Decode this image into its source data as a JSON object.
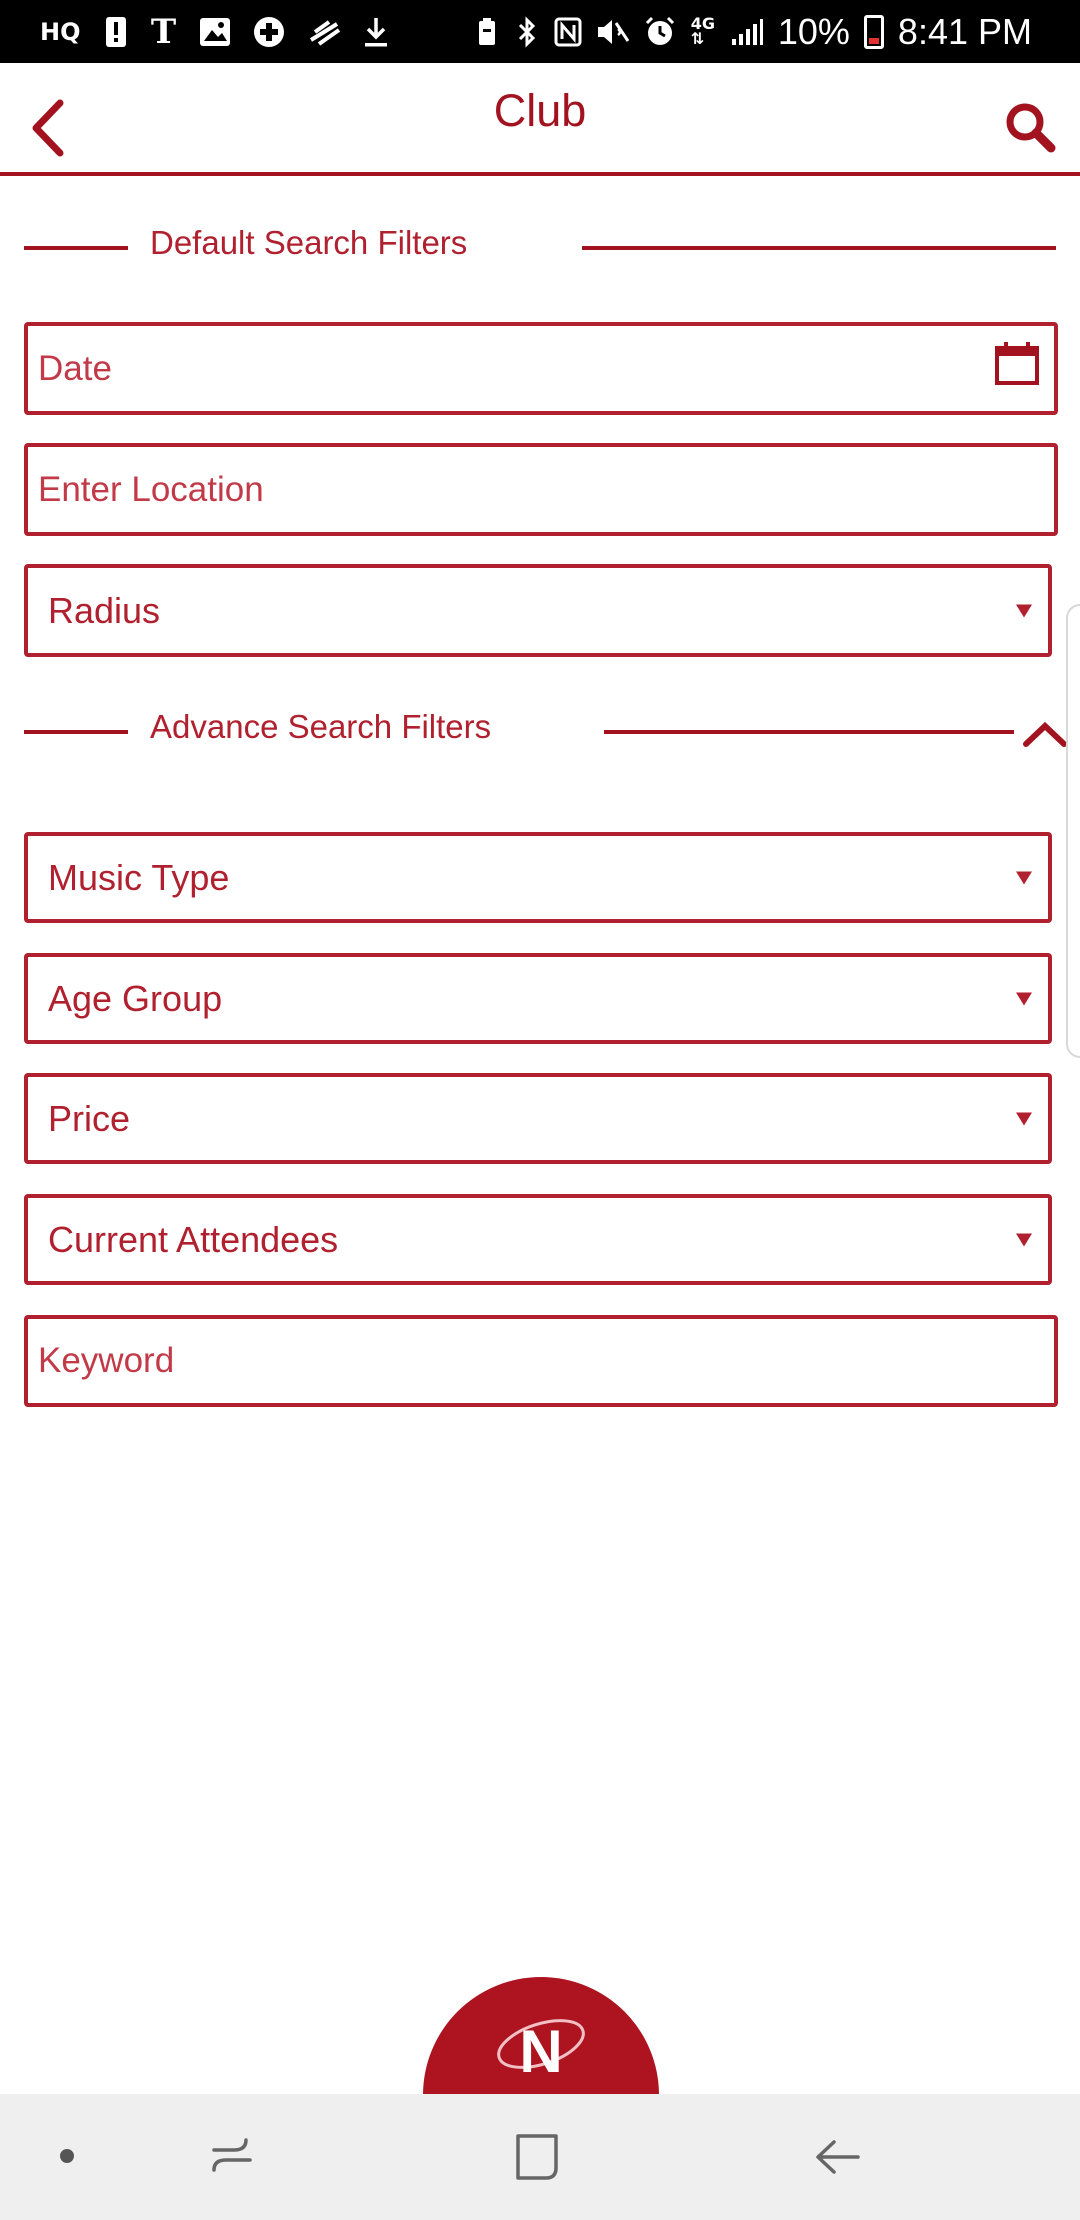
{
  "status_bar": {
    "left_icons": [
      "hq-icon",
      "alert-icon",
      "tmobile-icon",
      "image-icon",
      "plus-icon",
      "zip-icon",
      "download-icon"
    ],
    "battery_percent": "10%",
    "time": "8:41 PM"
  },
  "header": {
    "title": "Club"
  },
  "sections": {
    "default_title": "Default Search Filters",
    "advance_title": "Advance Search Filters"
  },
  "fields": {
    "date_placeholder": "Date",
    "location_placeholder": "Enter Location",
    "radius_label": "Radius",
    "music_type_label": "Music Type",
    "age_group_label": "Age Group",
    "price_label": "Price",
    "current_attendees_label": "Current Attendees",
    "keyword_placeholder": "Keyword"
  },
  "logo": {
    "letter": "N"
  },
  "colors": {
    "accent": "#a3131f",
    "text": "#b0202e",
    "nav_bg": "#efefef"
  }
}
